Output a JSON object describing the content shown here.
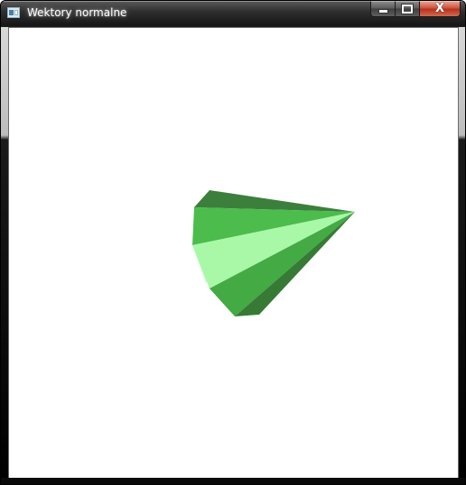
{
  "window": {
    "title": "Wektory normalne",
    "app_icon": "window-app-icon"
  },
  "title_controls": {
    "minimize_icon": "minimize-icon",
    "maximize_icon": "maximize-icon",
    "close_glyph": "X"
  },
  "scene": {
    "object": "cone",
    "background_color": "#ffffff",
    "face_colors": [
      "#3c7f3c",
      "#4cbc4c",
      "#a8f8a8",
      "#cfffcf",
      "#44aa44",
      "#367a36"
    ]
  }
}
